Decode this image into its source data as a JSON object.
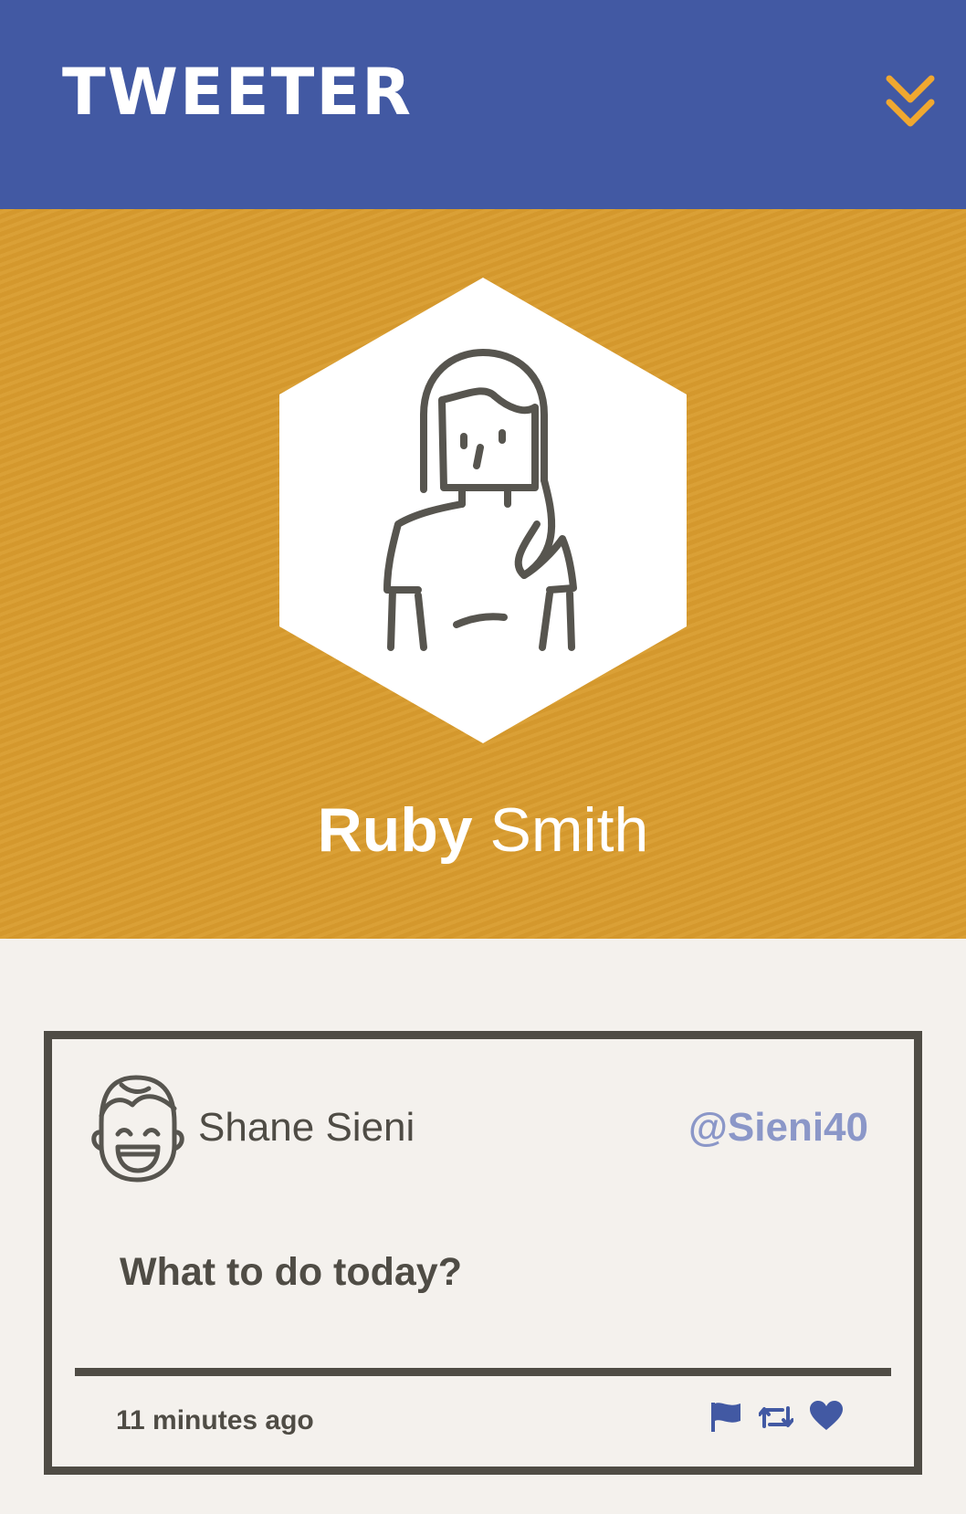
{
  "header": {
    "brand": "TWEETER",
    "menu_icon": "double-chevron-down-icon",
    "background_color": "#4259a3",
    "accent_color": "#f0a830"
  },
  "profile": {
    "first_name": "Ruby",
    "last_name": "Smith",
    "avatar_icon": "woman-avatar-icon",
    "banner_color": "#d99c2e"
  },
  "tweet": {
    "user_name": "Shane Sieni",
    "handle": "@Sieni40",
    "avatar_icon": "laughing-man-avatar-icon",
    "content": "What to do today?",
    "timestamp": "11 minutes ago",
    "actions": [
      {
        "name": "flag",
        "icon": "flag-icon"
      },
      {
        "name": "retweet",
        "icon": "retweet-icon"
      },
      {
        "name": "like",
        "icon": "heart-icon"
      }
    ],
    "action_color": "#4259a3"
  }
}
